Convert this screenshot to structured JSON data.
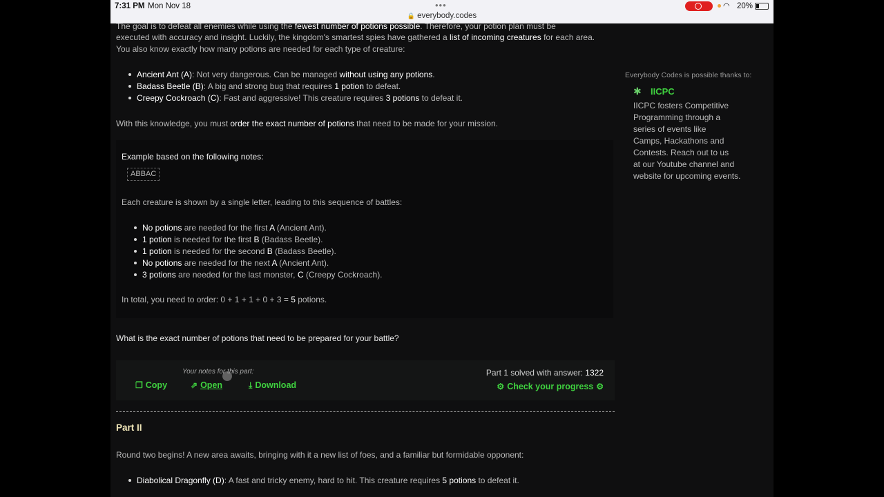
{
  "statusbar": {
    "time": "7:31 PM",
    "date": "Mon Nov 18",
    "url": "everybody.codes",
    "battery": "20%"
  },
  "intro": {
    "l1a": "The goal is to defeat all enemies while using the ",
    "l1b": "fewest number of potions possible",
    "l1c": ". Therefore, your potion plan must be",
    "l2a": "executed with accuracy and insight. Luckily, the kingdom's smartest spies have gathered a ",
    "l2b": "list of incoming creatures",
    "l2c": " for each area.",
    "l3": "You also know exactly how many potions are needed for each type of creature:"
  },
  "creatures": [
    {
      "name": "Ancient Ant (A)",
      "t1": ": Not very dangerous. Can be managed ",
      "h": "without using any potions",
      "t2": "."
    },
    {
      "name": "Badass Beetle (B)",
      "t1": ": A big and strong bug that requires ",
      "h": "1 potion",
      "t2": " to defeat."
    },
    {
      "name": "Creepy Cockroach (C)",
      "t1": ": Fast and aggressive! This creature requires ",
      "h": "3 potions",
      "t2": " to defeat it."
    }
  ],
  "knowledge": {
    "a": "With this knowledge, you must ",
    "b": "order the exact number of potions",
    "c": " that need to be made for your mission."
  },
  "example": {
    "title": "Example based on the following notes:",
    "code": "ABBAC",
    "desc": "Each creature is shown by a single letter, leading to this sequence of battles:",
    "steps": [
      {
        "h": "No potions",
        "t": " are needed for the first ",
        "l": "A",
        "e": " (Ancient Ant)."
      },
      {
        "h": "1 potion",
        "t": " is needed for the first ",
        "l": "B",
        "e": " (Badass Beetle)."
      },
      {
        "h": "1 potion",
        "t": " is needed for the second ",
        "l": "B",
        "e": " (Badass Beetle)."
      },
      {
        "h": "No potions",
        "t": " are needed for the next ",
        "l": "A",
        "e": " (Ancient Ant)."
      },
      {
        "h": "3 potions",
        "t": " are needed for the last monster, ",
        "l": "C",
        "e": " (Creepy Cockroach)."
      }
    ],
    "total_a": "In total, you need to order: 0 + 1 + 1 + 0 + 3 = ",
    "total_b": "5",
    "total_c": " potions."
  },
  "question": "What is the exact number of potions that need to be prepared for your battle?",
  "notes": {
    "label": "Your notes for this part:",
    "copy": "Copy",
    "open": "Open",
    "download": "Download"
  },
  "answer": {
    "prefix": "Part 1 solved with answer: ",
    "value": "1322",
    "progress": "Check your progress"
  },
  "part2": {
    "title": "Part II",
    "intro": "Round two begins! A new area awaits, bringing with it a new list of foes, and a familiar but formidable opponent:",
    "creature": {
      "name": "Diabolical Dragonfly (D)",
      "t1": ": A fast and tricky enemy, hard to hit. This creature requires ",
      "h": "5 potions",
      "t2": " to defeat it."
    }
  },
  "sponsor": {
    "header": "Everybody Codes is possible thanks to:",
    "name": "IICPC",
    "lines": [
      "IICPC fosters Competitive",
      "Programming through a",
      "series of events like",
      "Camps, Hackathons and",
      "Contests. Reach out to us",
      "at our Youtube channel and",
      "website for upcoming events."
    ]
  }
}
